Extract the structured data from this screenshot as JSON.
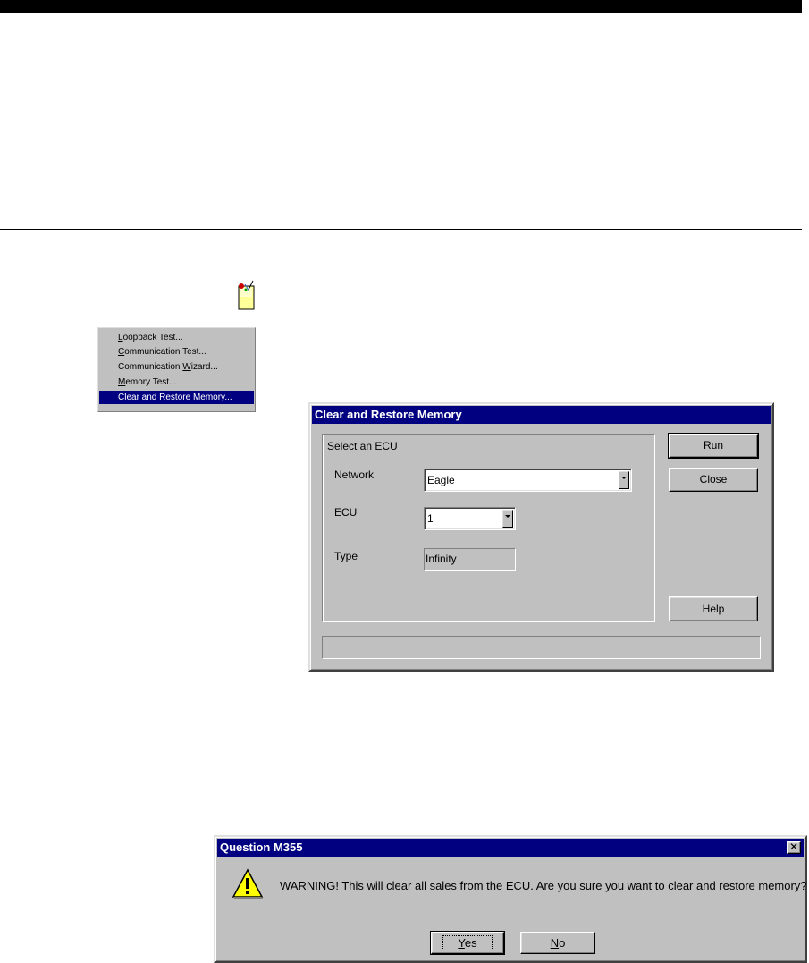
{
  "menu": {
    "items": [
      {
        "pre": "",
        "u": "L",
        "post": "oopback Test..."
      },
      {
        "pre": "",
        "u": "C",
        "post": "ommunication Test..."
      },
      {
        "pre": "Communication ",
        "u": "W",
        "post": "izard..."
      },
      {
        "pre": "",
        "u": "M",
        "post": "emory Test..."
      },
      {
        "pre": "Clear and ",
        "u": "R",
        "post": "estore Memory..."
      }
    ],
    "selected_index": 4
  },
  "clear_dialog": {
    "title": "Clear and Restore Memory",
    "group_label": "Select an ECU",
    "network_label": "Network",
    "network_value": "Eagle",
    "ecu_label": "ECU",
    "ecu_value": "1",
    "type_label": "Type",
    "type_value": "Infinity",
    "run_label": "Run",
    "close_label": "Close",
    "help_label": "Help",
    "status_text": ""
  },
  "question_dialog": {
    "title": "Question M355",
    "message": "WARNING! This will clear all sales from the ECU.  Are you sure you want to clear and restore memory?",
    "yes_u": "Y",
    "yes_rest": "es",
    "no_u": "N",
    "no_rest": "o",
    "icon": "warning-icon"
  },
  "colors": {
    "title_bar": "#000080",
    "dialog_face": "#c0c0c0",
    "menu_highlight": "#000080"
  }
}
